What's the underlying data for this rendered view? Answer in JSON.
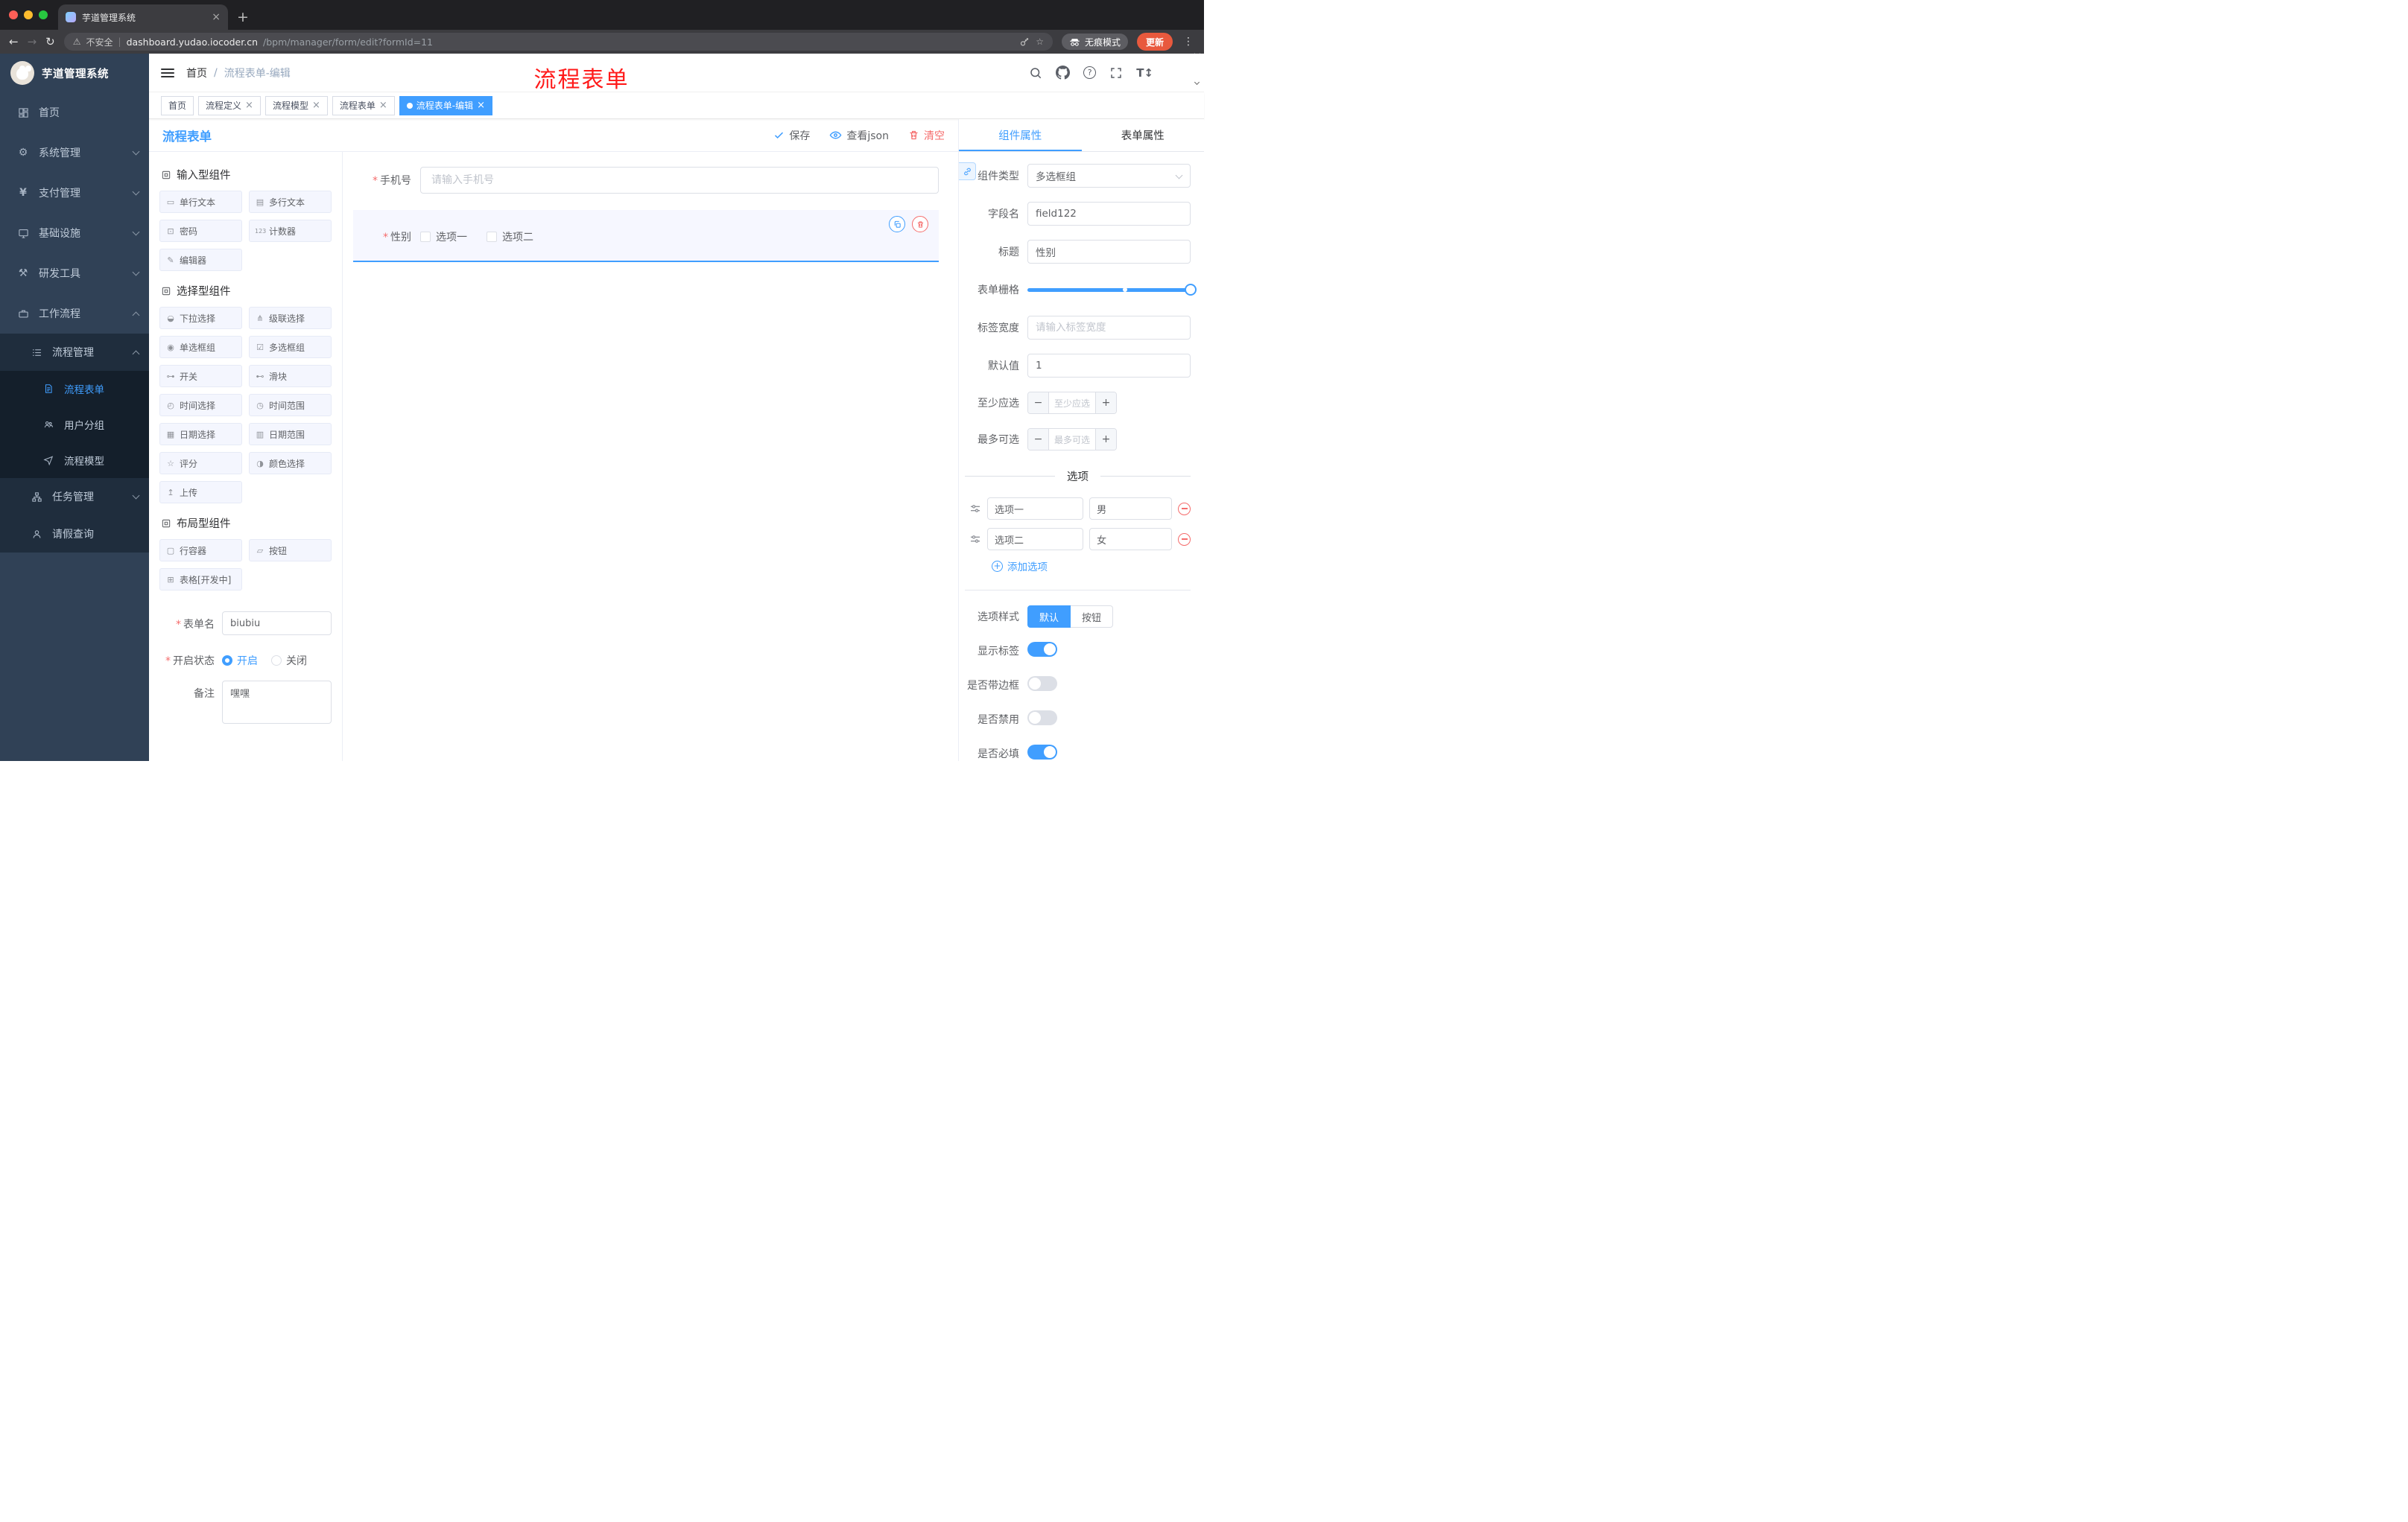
{
  "colors": {
    "accent": "#409eff",
    "danger": "#f56c6c",
    "sidebar_bg": "#304156",
    "sidebar_sub_bg": "#1f2d3d",
    "sidebar_sub2_bg": "#141f2b",
    "update_button": "#e8593d",
    "annotation_red": "#ff1a1a",
    "active_tag_bg": "#409eff"
  },
  "browser": {
    "tab_title": "芋道管理系统",
    "security_label": "不安全",
    "url_domain": "dashboard.yudao.iocoder.cn",
    "url_path": "/bpm/manager/form/edit?formId=11",
    "incognito_label": "无痕模式",
    "update_label": "更新"
  },
  "sidebar": {
    "logo_title": "芋道管理系统",
    "items": [
      {
        "icon": "dashboard",
        "label": "首页"
      },
      {
        "icon": "gear",
        "label": "系统管理"
      },
      {
        "icon": "yen",
        "label": "支付管理"
      },
      {
        "icon": "monitor",
        "label": "基础设施"
      },
      {
        "icon": "tools",
        "label": "研发工具"
      },
      {
        "icon": "briefcase",
        "label": "工作流程"
      }
    ],
    "process_group": {
      "icon": "list",
      "label": "流程管理",
      "children": [
        {
          "icon": "document",
          "label": "流程表单"
        },
        {
          "icon": "users",
          "label": "用户分组"
        },
        {
          "icon": "send",
          "label": "流程模型"
        }
      ]
    },
    "task_group": {
      "icon": "tree",
      "label": "任务管理"
    },
    "leave_item": {
      "icon": "person",
      "label": "请假查询"
    }
  },
  "header": {
    "breadcrumb_home": "首页",
    "breadcrumb_current": "流程表单-编辑",
    "annotation": "流程表单"
  },
  "tags": [
    {
      "label": "首页"
    },
    {
      "label": "流程定义"
    },
    {
      "label": "流程模型"
    },
    {
      "label": "流程表单"
    },
    {
      "label": "流程表单-编辑"
    }
  ],
  "designer": {
    "title": "流程表单",
    "save_label": "保存",
    "view_json_label": "查看json",
    "clear_label": "清空",
    "palette": {
      "groups": [
        {
          "title": "输入型组件",
          "items": [
            {
              "icon": "▭",
              "name": "single-line-text",
              "label": "单行文本"
            },
            {
              "icon": "▤",
              "name": "multi-line-text",
              "label": "多行文本"
            },
            {
              "icon": "⊡",
              "name": "password",
              "label": "密码"
            },
            {
              "icon": "123",
              "name": "counter",
              "label": "计数器"
            },
            {
              "icon": "✎",
              "name": "editor",
              "label": "编辑器"
            }
          ]
        },
        {
          "title": "选择型组件",
          "items": [
            {
              "icon": "◒",
              "name": "select",
              "label": "下拉选择"
            },
            {
              "icon": "⋔",
              "name": "cascader",
              "label": "级联选择"
            },
            {
              "icon": "◉",
              "name": "radio-group",
              "label": "单选框组"
            },
            {
              "icon": "☑",
              "name": "checkbox-group",
              "label": "多选框组"
            },
            {
              "icon": "⊶",
              "name": "switch",
              "label": "开关"
            },
            {
              "icon": "⊷",
              "name": "slider",
              "label": "滑块"
            },
            {
              "icon": "◴",
              "name": "time-picker",
              "label": "时间选择"
            },
            {
              "icon": "◷",
              "name": "time-range",
              "label": "时间范围"
            },
            {
              "icon": "▦",
              "name": "date-picker",
              "label": "日期选择"
            },
            {
              "icon": "▥",
              "name": "date-range",
              "label": "日期范围"
            },
            {
              "icon": "☆",
              "name": "rate",
              "label": "评分"
            },
            {
              "icon": "◑",
              "name": "color-picker",
              "label": "颜色选择"
            },
            {
              "icon": "↥",
              "name": "upload",
              "label": "上传"
            }
          ]
        },
        {
          "title": "布局型组件",
          "items": [
            {
              "icon": "▢",
              "name": "row-container",
              "label": "行容器"
            },
            {
              "icon": "▱",
              "name": "button",
              "label": "按钮"
            },
            {
              "icon": "⊞",
              "name": "table-dev",
              "label": "表格[开发中]"
            }
          ]
        }
      ]
    },
    "meta": {
      "form_name_label": "表单名",
      "form_name_value": "biubiu",
      "status_label": "开启状态",
      "status_on_label": "开启",
      "status_off_label": "关闭",
      "remark_label": "备注",
      "remark_value": "嘿嘿"
    },
    "canvas": {
      "phone_label": "手机号",
      "phone_placeholder": "请输入手机号",
      "gender_label": "性别",
      "gender_options": [
        "选项一",
        "选项二"
      ]
    }
  },
  "props": {
    "tab_component": "组件属性",
    "tab_form": "表单属性",
    "component_type_label": "组件类型",
    "component_type_value": "多选框组",
    "field_name_label": "字段名",
    "field_name_value": "field122",
    "title_label": "标题",
    "title_value": "性别",
    "grid_label": "表单栅格",
    "label_width_label": "标签宽度",
    "label_width_placeholder": "请输入标签宽度",
    "default_label": "默认值",
    "default_value": "1",
    "min_label": "至少应选",
    "min_placeholder": "至少应选",
    "max_label": "最多可选",
    "max_placeholder": "最多可选",
    "options_divider": "选项",
    "options": [
      {
        "name": "选项一",
        "value": "男"
      },
      {
        "name": "选项二",
        "value": "女"
      }
    ],
    "add_option_label": "添加选项",
    "option_style_label": "选项样式",
    "style_default": "默认",
    "style_button": "按钮",
    "show_label_label": "显示标签",
    "border_label": "是否带边框",
    "disabled_label": "是否禁用",
    "required_label": "是否必填"
  }
}
